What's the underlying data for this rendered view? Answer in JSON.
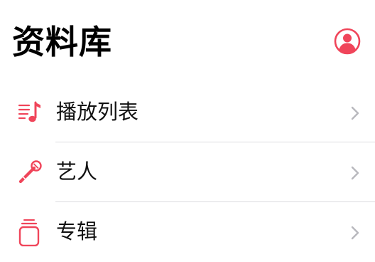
{
  "header": {
    "title": "资料库",
    "account_icon": "person-circle-icon"
  },
  "colors": {
    "accent": "#f0455a",
    "chevron": "#b8b8bd",
    "divider": "#dcdcdf"
  },
  "library_items": [
    {
      "label": "播放列表",
      "icon": "playlist-icon"
    },
    {
      "label": "艺人",
      "icon": "microphone-icon"
    },
    {
      "label": "专辑",
      "icon": "album-stack-icon"
    }
  ]
}
